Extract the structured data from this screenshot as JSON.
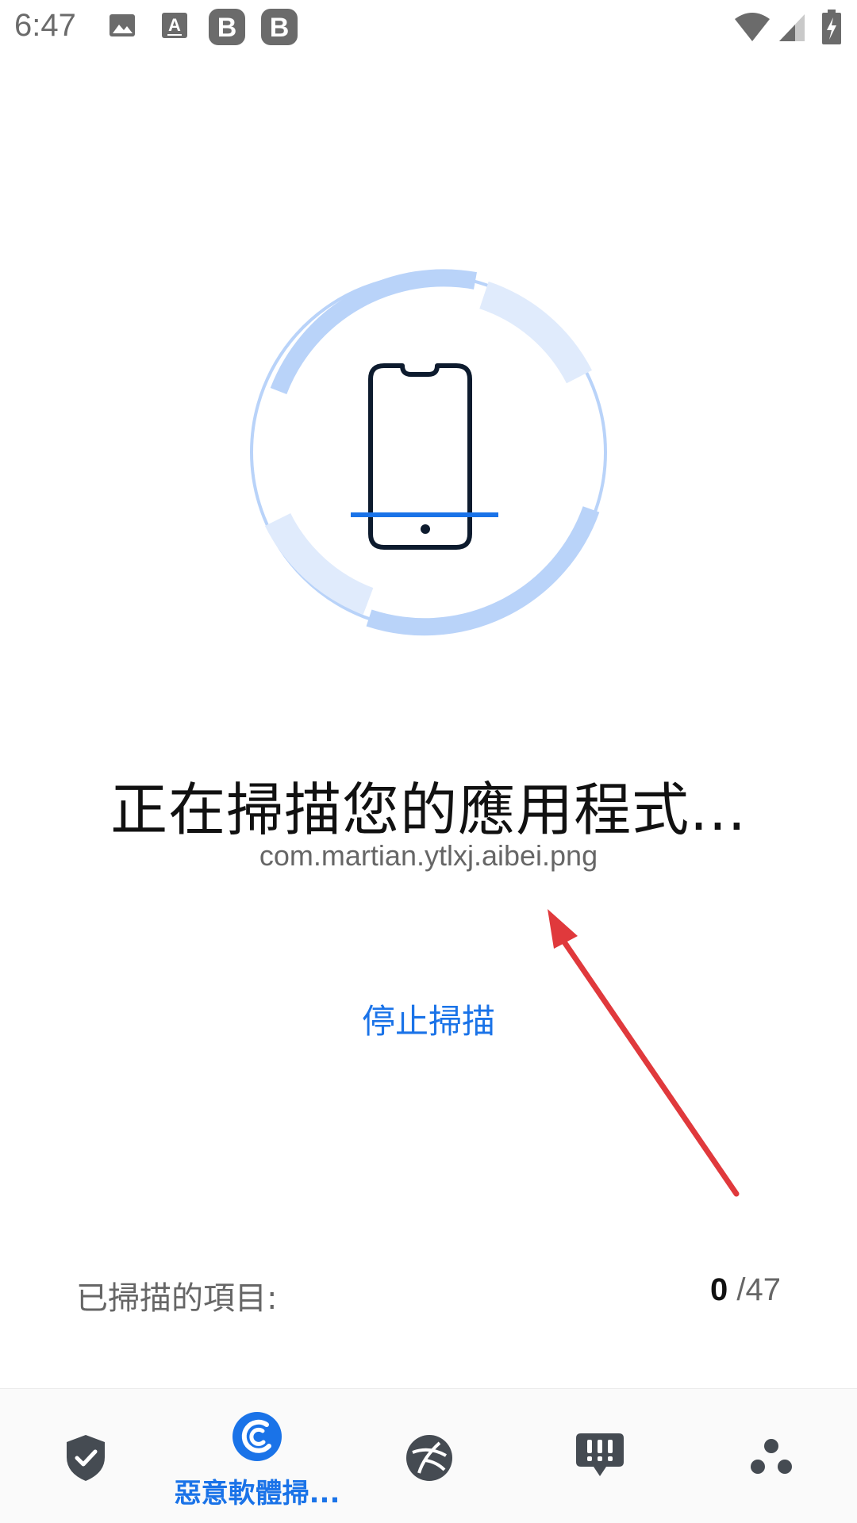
{
  "status_bar": {
    "time": "6:47",
    "icons": [
      "image-icon",
      "a-notification-icon",
      "b-app-icon",
      "b-app-icon",
      "wifi-icon",
      "signal-icon",
      "battery-charging-icon"
    ]
  },
  "scan": {
    "title": "正在掃描您的應用程式...",
    "current_item": "com.martian.ytlxj.aibei.png",
    "stop_label": "停止掃描"
  },
  "progress": {
    "label": "已掃描的項目:",
    "scanned": "0",
    "total": "/47"
  },
  "bottom_nav": {
    "items": [
      {
        "icon": "shield-check-icon",
        "label": ""
      },
      {
        "icon": "malware-scan-icon",
        "label": "惡意軟體掃..."
      },
      {
        "icon": "web-protection-icon",
        "label": ""
      },
      {
        "icon": "message-alert-icon",
        "label": ""
      },
      {
        "icon": "more-dots-icon",
        "label": ""
      }
    ],
    "active_index": 1
  },
  "colors": {
    "accent": "#1a73e8",
    "ring_strong": "#b9d3f9",
    "ring_light": "#e0ebfc",
    "phone_outline": "#0d1b2e",
    "arrow": "#e0393c",
    "nav_icon": "#454b52"
  }
}
